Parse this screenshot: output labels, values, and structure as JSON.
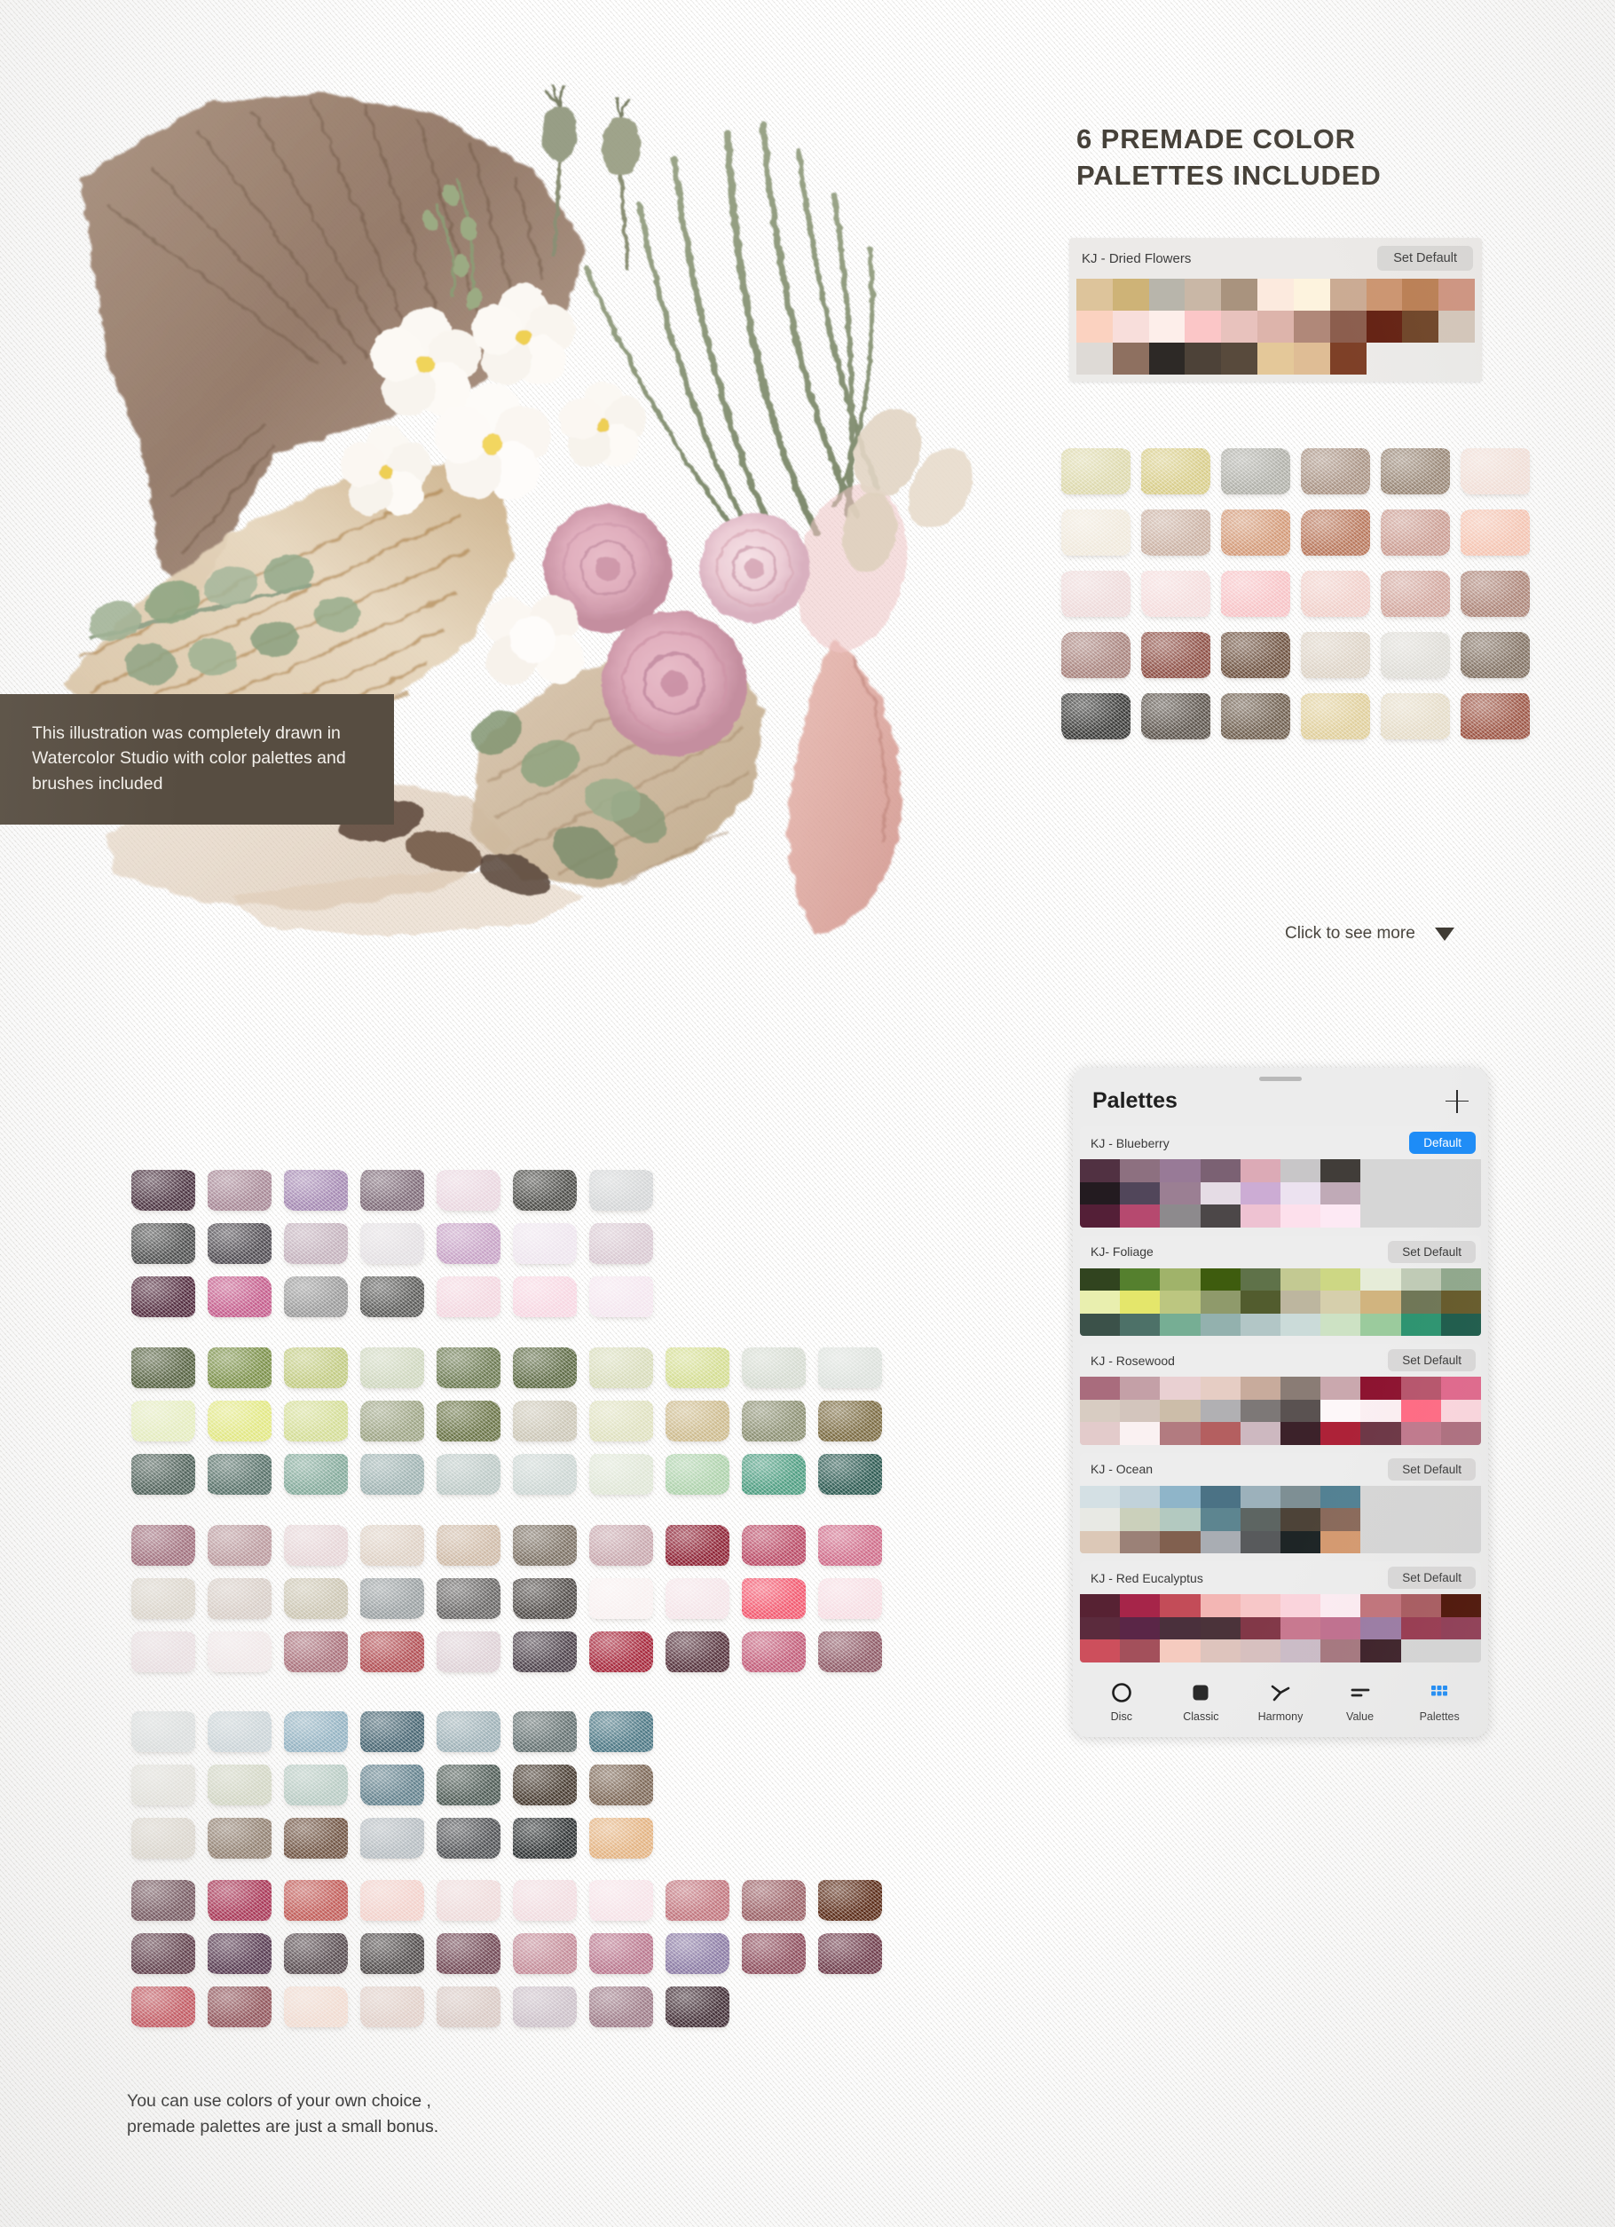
{
  "headline": {
    "line1": "6 PREMADE COLOR",
    "line2": "PALETTES INCLUDED"
  },
  "overlay_caption": "This illustration was completely drawn in Watercolor Studio with color palettes and brushes included",
  "bottom_caption": "You can use colors of your own choice , premade palettes are just a small bonus.",
  "see_more": {
    "label": "Click to see more",
    "icon": "caret-down-icon"
  },
  "dried_palette": {
    "name": "KJ - Dried Flowers",
    "button": "Set Default",
    "colors": [
      "#ddc49b",
      "#ceb377",
      "#b8b5ab",
      "#c9b7a6",
      "#a9937e",
      "#fceade",
      "#fdf3de",
      "#cbab93",
      "#cc9570",
      "#bb7f54",
      "#cf9480",
      "#fbd2c0",
      "#f8dedb",
      "#fdeeea",
      "#fbc6c7",
      "#e8c2bd",
      "#ddb4ab",
      "#b08879",
      "#8c5e4e",
      "#652213",
      "#6f4528",
      "#d4c7ba",
      "#dedad6",
      "#8e7060",
      "#2d2926",
      "#4d4238",
      "#584a3c",
      "#e4c899",
      "#dfbd95",
      "#7e4027"
    ]
  },
  "top_watercolor_swatches": {
    "rows": [
      [
        "#ddd9ad",
        "#d8cd8a",
        "#b0b0a9",
        "#a99384",
        "#988675",
        "#f3e0d8"
      ],
      [
        "#f0e9dc",
        "#cbb2a4",
        "#d39a78",
        "#b8775b",
        "#cb9d92",
        "#f7c5b2"
      ],
      [
        "#eedada",
        "#f4dcdc",
        "#f7c3c6",
        "#f0cfc9",
        "#d2a79e",
        "#ac8376"
      ],
      [
        "#a8837d",
        "#8d4f45",
        "#6e5240",
        "#ddd3c6",
        "#dedcd6",
        "#7f6e5f"
      ],
      [
        "#3a3a38",
        "#5c544c",
        "#6f5f4f",
        "#e0cf9c",
        "#e5dcc8",
        "#9b5241"
      ]
    ]
  },
  "left_swatch_groups": [
    {
      "name": "mauve-group",
      "rows": [
        [
          "#4a3240",
          "#a78896",
          "#a58ab3",
          "#7e6b78",
          "#ead7e0",
          "#4c4c48",
          "#d4d6d7"
        ],
        [
          "#4b4c4c",
          "#4f4b51",
          "#c4b2bd",
          "#e3dfe2",
          "#c7a3c6",
          "#eee5ee",
          "#d9c9d2"
        ],
        [
          "#50293c",
          "#c45d8c",
          "#9a9a9a",
          "#5a5a58",
          "#f3d7e0",
          "#f7d7e2",
          "#f4e6ef"
        ]
      ]
    },
    {
      "name": "foliage-group",
      "rows": [
        [
          "#54603f",
          "#7b9049",
          "#c2cb83",
          "#cfd7bf",
          "#6c7a52",
          "#5d6a44",
          "#d8dcbb",
          "#d4dd92",
          "#d5dbd1",
          "#dce1dc"
        ],
        [
          "#e6eec0",
          "#e2e884",
          "#d4dd97",
          "#9ea586",
          "#6a7447",
          "#ccc7b7",
          "#dfe1c0",
          "#cdbb8e",
          "#8c9073",
          "#7b6b42"
        ],
        [
          "#4b5e56",
          "#567068",
          "#84aa9b",
          "#9fb3b2",
          "#bcc9c6",
          "#ccd6d3",
          "#dfe6d6",
          "#aed2ac",
          "#4e9d81",
          "#2d5a52"
        ]
      ]
    },
    {
      "name": "rosewood-group",
      "rows": [
        [
          "#a06e7c",
          "#bb9a9e",
          "#e6d5d7",
          "#ded1c5",
          "#cfbba8",
          "#7c7164",
          "#c8a8ae",
          "#8d2234",
          "#b94b66",
          "#cf6d8a"
        ],
        [
          "#ddd7cd",
          "#d9cfc8",
          "#ccc6b3",
          "#9aa0a2",
          "#676564",
          "#4f4a47",
          "#f8f0f0",
          "#f4e4e8",
          "#f2596f",
          "#f6dde3"
        ],
        [
          "#ece1e4",
          "#f2e9ea",
          "#a9707a",
          "#b14f54",
          "#ded1d6",
          "#4c414a",
          "#a5263a",
          "#55323c",
          "#c25d79",
          "#8e5a66"
        ]
      ]
    },
    {
      "name": "ocean-group",
      "rows": [
        [
          "#dde1e1",
          "#ccd6da",
          "#93b3c3",
          "#476572",
          "#9eb1b7",
          "#637070",
          "#4c7784"
        ],
        [
          "#e5e4de",
          "#d4d8c6",
          "#b8ccc4",
          "#61808c",
          "#4e5b55",
          "#473b30",
          "#7c6756"
        ],
        [
          "#ded9d0",
          "#8f7d6d",
          "#6c4f3d",
          "#b6bdc2",
          "#4e5053",
          "#2e3233",
          "#e3b382"
        ]
      ]
    },
    {
      "name": "plum-group",
      "rows": [
        [
          "#6f5059",
          "#a62b4e",
          "#c25753",
          "#f5d3cd",
          "#f0dcdc",
          "#f2dde1",
          "#f6e3e8",
          "#c1767e",
          "#9a6166",
          "#5a2b17"
        ],
        [
          "#55313f",
          "#4d2e47",
          "#4f4247",
          "#4a4545",
          "#6e4451",
          "#c48b98",
          "#b9768d",
          "#8a7aa4",
          "#8c4c5b",
          "#6d3b4a"
        ],
        [
          "#c34d57",
          "#8c4a51",
          "#f6dfd4",
          "#e4d2cb",
          "#dbcbc6",
          "#cdc1ca",
          "#9d7a87",
          "#3f2b33"
        ]
      ]
    }
  ],
  "panel": {
    "title": "Palettes",
    "add_icon": "plus-icon",
    "grabber": "drag-handle",
    "palettes": [
      {
        "name": "KJ - Blueberry",
        "button": "Default",
        "is_default": true,
        "colors": [
          "#513142",
          "#8d7080",
          "#987a97",
          "#7b6173",
          "#dcaab6",
          "#c8c6c8",
          "#413d39",
          "",
          "",
          "",
          "#231b20",
          "#51465a",
          "#9b7f93",
          "#e5dce5",
          "#ccacd4",
          "#ece2f0",
          "#c0aab7",
          "",
          "",
          "",
          "#541f37",
          "#b6496f",
          "#8d8a8d",
          "#4c4748",
          "#eec2d2",
          "#fde0ec",
          "#fde9f4",
          "",
          "",
          ""
        ]
      },
      {
        "name": "KJ- Foliage",
        "button": "Set Default",
        "is_default": false,
        "colors": [
          "#31441f",
          "#55802e",
          "#a0b36a",
          "#3e5c0e",
          "#5f7249",
          "#c3c992",
          "#cdd784",
          "#e6ecd8",
          "#c0cbb6",
          "#90a88c",
          "#e9efaf",
          "#e4e66b",
          "#bcc680",
          "#8f9a6b",
          "#525c2e",
          "#bdb69f",
          "#d6cfac",
          "#d1b47f",
          "#6f7656",
          "#665a2a",
          "#3b5149",
          "#4d7168",
          "#76ae94",
          "#93b1ae",
          "#b2c6c6",
          "#cbdbd9",
          "#cde2c4",
          "#9bcb9d",
          "#2d9470",
          "#1d5b4b"
        ]
      },
      {
        "name": "KJ - Rosewood",
        "button": "Set Default",
        "is_default": false,
        "colors": [
          "#a96c7d",
          "#c4a0a7",
          "#e9d0d2",
          "#e6cdc4",
          "#c8ab9c",
          "#8a7c75",
          "#caa8ae",
          "#8d1330",
          "#b7556c",
          "#e0688c",
          "#d8ccc2",
          "#d3c5bd",
          "#ccbda9",
          "#b1b0b3",
          "#7d7877",
          "#5a5251",
          "#fdf7f9",
          "#fbeff2",
          "#ff6b84",
          "#fbd6de",
          "#e3cbcb",
          "#faf1f2",
          "#b27b80",
          "#b45f60",
          "#cdb8c0",
          "#3c222a",
          "#ad2238",
          "#6d3746",
          "#c0798d",
          "#ad6f7f"
        ]
      },
      {
        "name": "KJ - Ocean",
        "button": "Set Default",
        "is_default": false,
        "colors": [
          "#d4e0e4",
          "#c1d2da",
          "#8fb5c9",
          "#4b7285",
          "#9cb1bb",
          "#7e8f94",
          "#538193",
          "",
          "",
          "",
          "#e8e9e4",
          "#cbd0bb",
          "#b3c9c0",
          "#5d8590",
          "#5d6562",
          "#4d4338",
          "#8a6a5b",
          "",
          "",
          "",
          "#dcc8b7",
          "#9b8177",
          "#81604f",
          "#a9adb3",
          "#585a5c",
          "#1e2526",
          "#d49a70",
          "",
          "",
          ""
        ]
      },
      {
        "name": "KJ - Red Eucalyptus",
        "button": "Set Default",
        "is_default": false,
        "colors": [
          "#572233",
          "#a62549",
          "#c34c58",
          "#f3b6b4",
          "#f7c7c8",
          "#fbd4dc",
          "#fcecf2",
          "#c1737b",
          "#a85a5f",
          "#4c1104",
          "#5b2b3d",
          "#5a2647",
          "#4a303c",
          "#4b333a",
          "#823848",
          "#c8788f",
          "#c0708f",
          "#9b7ba4",
          "#97384f",
          "#8e3a53",
          "#cd4f5c",
          "#a3505b",
          "#f5cbbf",
          "#dec4bd",
          "#d7c0bf",
          "#cbbcc7",
          "#a5777f",
          "#3c2028",
          "",
          ""
        ]
      }
    ],
    "toolbar": [
      {
        "label": "Disc",
        "icon": "disc-icon",
        "active": false
      },
      {
        "label": "Classic",
        "icon": "classic-square-icon",
        "active": false
      },
      {
        "label": "Harmony",
        "icon": "harmony-icon",
        "active": false
      },
      {
        "label": "Value",
        "icon": "value-lines-icon",
        "active": false
      },
      {
        "label": "Palettes",
        "icon": "palettes-grid-icon",
        "active": true
      }
    ],
    "accent_color": "#1d8cf7"
  }
}
